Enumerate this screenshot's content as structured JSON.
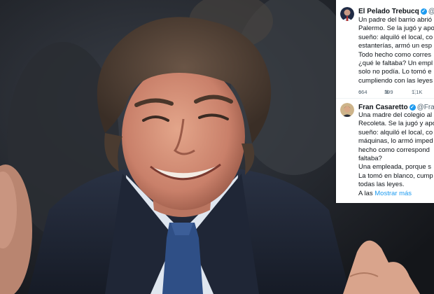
{
  "tweet1": {
    "name": "El Pelado Trebucq",
    "handle": "@p",
    "lines": [
      "Un padre del barrio abrió",
      "Palermo. Se la jugó y apo",
      "sueño: alquiló el local, co",
      "estanterías, armó un esp",
      "Todo hecho como corres",
      "¿qué le faltaba? Un empl",
      "solo no podía. Lo tomó e",
      "cumpliendo con las leyes"
    ],
    "replies": "664",
    "retweets": "399",
    "likes": "1,1K"
  },
  "tweet2": {
    "name": "Fran Casaretto",
    "handle": "@Frar",
    "lines": [
      "Una madre del colegio al",
      "Recoleta. Se la jugó y apo",
      "sueño: alquiló el local, co",
      "máquinas, lo armó imped",
      "hecho como correspond",
      "faltaba?",
      "Una empleada, porque s",
      "La tomó en blanco, cump",
      "todas las leyes."
    ],
    "showmore_prefix": "A las",
    "showmore_label": "Mostrar más"
  },
  "colors": {
    "verified": "#1d9bf0",
    "link": "#1d9bf0",
    "suit": "#1c2333",
    "tie": "#2f4f86",
    "shirt": "#dfe6ef"
  },
  "icons": [
    "verified-icon",
    "reply-icon",
    "retweet-icon",
    "like-icon"
  ]
}
